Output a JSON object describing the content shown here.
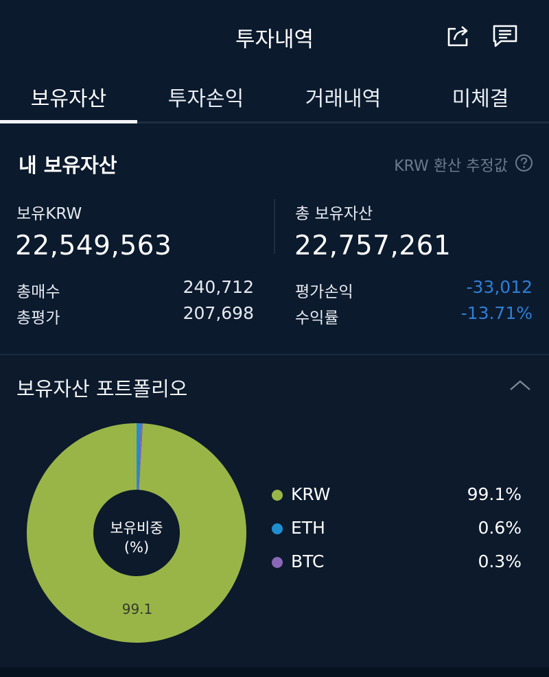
{
  "header": {
    "title": "투자내역",
    "share_icon": "share-icon",
    "message_icon": "message-icon"
  },
  "tabs": [
    {
      "label": "보유자산",
      "active": true
    },
    {
      "label": "투자손익",
      "active": false
    },
    {
      "label": "거래내역",
      "active": false
    },
    {
      "label": "미체결",
      "active": false
    }
  ],
  "holdings": {
    "title": "내 보유자산",
    "krw_note": "KRW 환산 추정값",
    "help_icon": "question-circle-icon",
    "krw_label": "보유KRW",
    "krw_value": "22,549,563",
    "total_label": "총 보유자산",
    "total_value": "22,757,261",
    "buy_label": "총매수",
    "buy_value": "240,712",
    "eval_label": "총평가",
    "eval_value": "207,698",
    "pnl_label": "평가손익",
    "pnl_value": "-33,012",
    "rate_label": "수익률",
    "rate_value": "-13.71%",
    "negative_color": "#2f7fd6"
  },
  "portfolio": {
    "title": "보유자산 포트폴리오",
    "collapse_icon": "chevron-up-icon",
    "center_label_line1": "보유비중",
    "center_label_line2": "(%)",
    "slice_label": "99.1",
    "legend": [
      {
        "name": "KRW",
        "value": "99.1%",
        "color": "#99b548"
      },
      {
        "name": "ETH",
        "value": "0.6%",
        "color": "#1f8fd0"
      },
      {
        "name": "BTC",
        "value": "0.3%",
        "color": "#8a68b8"
      }
    ]
  },
  "chart_data": {
    "type": "pie",
    "categories": [
      "KRW",
      "ETH",
      "BTC"
    ],
    "values": [
      99.1,
      0.6,
      0.3
    ],
    "colors": [
      "#99b548",
      "#1f8fd0",
      "#8a68b8"
    ],
    "title": "보유비중 (%)"
  }
}
